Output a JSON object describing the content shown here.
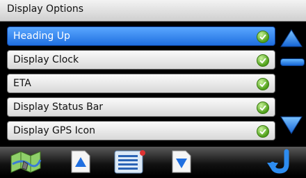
{
  "window": {
    "title": "Display Options"
  },
  "list": {
    "items": [
      {
        "label": "Heading Up",
        "checked": true,
        "selected": true
      },
      {
        "label": "Display Clock",
        "checked": true,
        "selected": false
      },
      {
        "label": "ETA",
        "checked": true,
        "selected": false
      },
      {
        "label": "Display Status Bar",
        "checked": true,
        "selected": false
      },
      {
        "label": "Display GPS Icon",
        "checked": true,
        "selected": false
      }
    ]
  },
  "scrollbar": {
    "position_fraction": 0.15
  },
  "toolbar": {
    "buttons": [
      {
        "icon": "map-icon"
      },
      {
        "icon": "page-up-icon"
      },
      {
        "icon": "list-menu-icon"
      },
      {
        "icon": "page-down-icon"
      },
      {
        "icon": "back-arrow-icon"
      }
    ]
  },
  "colors": {
    "accent": "#1f6fe0",
    "check": "#4fa019",
    "background": "#000000"
  }
}
